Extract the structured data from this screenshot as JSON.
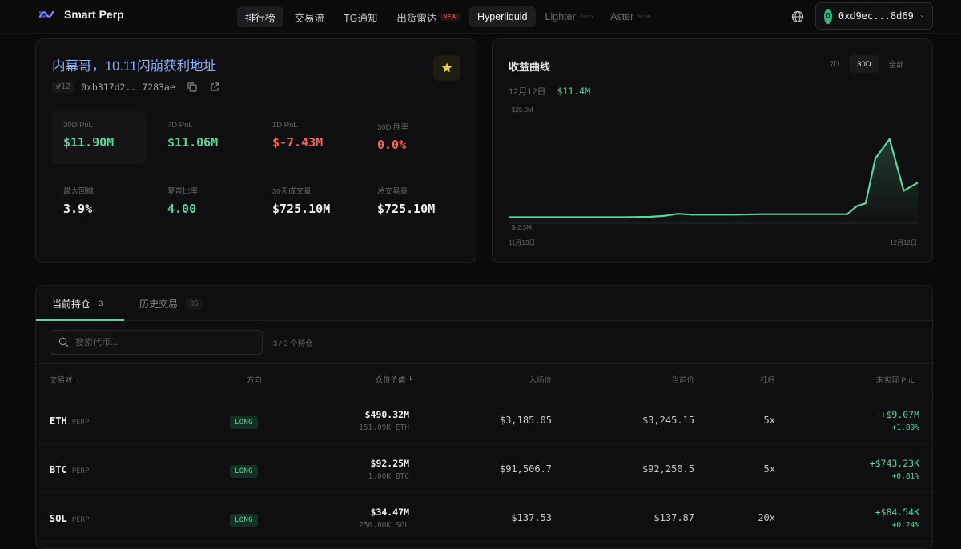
{
  "nav": {
    "brand": "Smart Perp",
    "links": [
      {
        "label": "排行榜",
        "active": true
      },
      {
        "label": "交易流",
        "active": false
      },
      {
        "label": "TG通知",
        "active": false
      },
      {
        "label": "出货雷达",
        "active": false,
        "badge": "NEW"
      }
    ],
    "exchanges": [
      {
        "label": "Hyperliquid",
        "active": true
      },
      {
        "label": "Lighter",
        "soon": "Soon"
      },
      {
        "label": "Aster",
        "soon": "Soon"
      }
    ],
    "wallet": {
      "avatar": "0",
      "address": "0xd9ec...8d69"
    }
  },
  "profile": {
    "title": "内幕哥，10.11闪崩获利地址",
    "rank": "#12",
    "address": "0xb317d2...7283ae",
    "stats": [
      {
        "label": "30D PnL",
        "value": "$11.90M",
        "tone": "green",
        "highlight": true
      },
      {
        "label": "7D PnL",
        "value": "$11.06M",
        "tone": "green"
      },
      {
        "label": "1D PnL",
        "value": "$-7.43M",
        "tone": "red"
      },
      {
        "label": "30D 胜率",
        "value": "0.0%",
        "tone": "red"
      },
      {
        "label": "最大回撤",
        "value": "3.9%",
        "tone": "white"
      },
      {
        "label": "夏普比率",
        "value": "4.00",
        "tone": "green"
      },
      {
        "label": "30天成交量",
        "value": "$725.10M",
        "tone": "white"
      },
      {
        "label": "总交易量",
        "value": "$725.10M",
        "tone": "white"
      }
    ]
  },
  "pnl_chart": {
    "title": "收益曲线",
    "ranges": [
      "7D",
      "30D",
      "全部"
    ],
    "active_range": "30D",
    "date": "12月12日",
    "value": "$11.4M",
    "y_top_label": "$25.0M",
    "y_bottom_label": "$-2.3M",
    "x_start_label": "11月13日",
    "x_end_label": "12月12日"
  },
  "chart_data": {
    "type": "area",
    "ylim": [
      -2.3,
      25.0
    ],
    "y_unit": "$M",
    "x_start": "11月13日",
    "x_end": "12月12日",
    "points": [
      [
        0,
        0
      ],
      [
        2,
        0
      ],
      [
        4,
        0
      ],
      [
        6,
        0
      ],
      [
        8,
        0
      ],
      [
        10,
        0.1
      ],
      [
        11,
        0.3
      ],
      [
        12,
        0.8
      ],
      [
        13,
        0.6
      ],
      [
        14,
        0.6
      ],
      [
        16,
        0.6
      ],
      [
        18,
        0.7
      ],
      [
        20,
        0.7
      ],
      [
        22,
        0.7
      ],
      [
        24,
        0.7
      ],
      [
        24.7,
        2.6
      ],
      [
        25.3,
        3.2
      ],
      [
        26,
        13.6
      ],
      [
        27,
        18.0
      ],
      [
        28,
        6.1
      ],
      [
        29,
        8.0
      ]
    ]
  },
  "positions": {
    "tabs": [
      {
        "label": "当前持仓",
        "count": "3",
        "active": true
      },
      {
        "label": "历史交易",
        "count": "35",
        "active": false
      }
    ],
    "search_placeholder": "搜索代币...",
    "count_text": "3 / 3 个持仓",
    "columns": [
      "交易对",
      "方向",
      "仓位价值",
      "入场价",
      "当前价",
      "杠杆",
      "未实现 PnL"
    ],
    "rows": [
      {
        "symbol": "ETH",
        "type": "PERP",
        "side": "LONG",
        "value": "$490.32M",
        "size": "151.09K ETH",
        "entry": "$3,185.05",
        "mark": "$3,245.15",
        "leverage": "5x",
        "pnl": "+$9.07M",
        "pnl_pct": "+1.89%"
      },
      {
        "symbol": "BTC",
        "type": "PERP",
        "side": "LONG",
        "value": "$92.25M",
        "size": "1.00K BTC",
        "entry": "$91,506.7",
        "mark": "$92,250.5",
        "leverage": "5x",
        "pnl": "+$743.23K",
        "pnl_pct": "+0.81%"
      },
      {
        "symbol": "SOL",
        "type": "PERP",
        "side": "LONG",
        "value": "$34.47M",
        "size": "250.00K SOL",
        "entry": "$137.53",
        "mark": "$137.87",
        "leverage": "20x",
        "pnl": "+$84.54K",
        "pnl_pct": "+0.24%"
      }
    ]
  },
  "colors": {
    "accent": "#5fd49b",
    "negative": "#ff5f5f",
    "title": "#8fb0ff"
  }
}
